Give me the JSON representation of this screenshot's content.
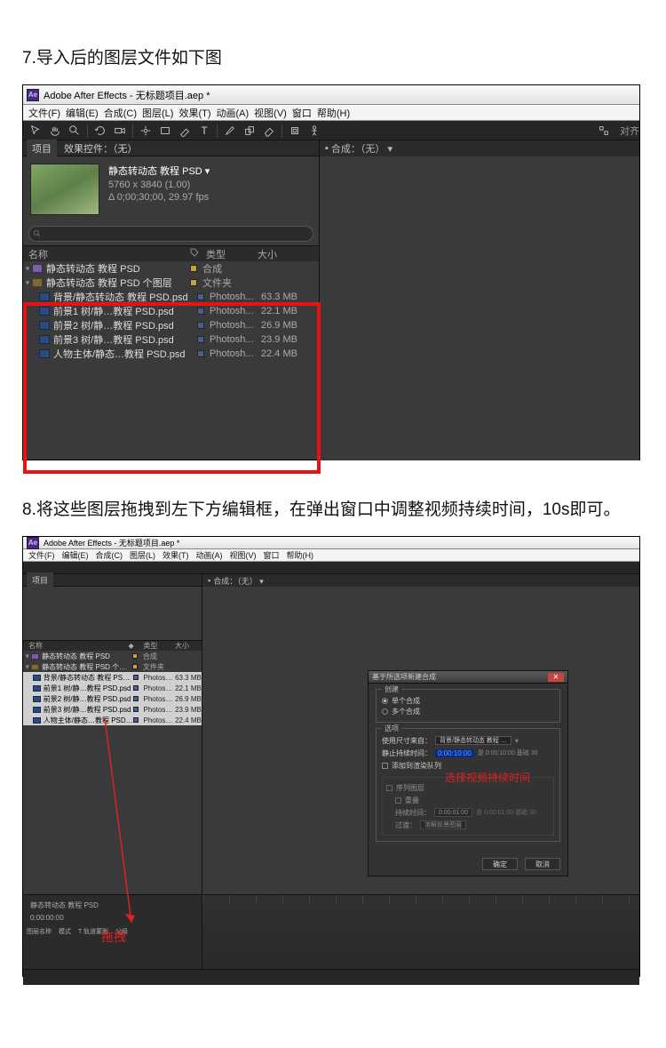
{
  "step7_text": "7.导入后的图层文件如下图",
  "step8_text": "8.将这些图层拖拽到左下方编辑框，在弹出窗口中调整视频持续时间，10s即可。",
  "ae": {
    "app_logo": "Ae",
    "title": "Adobe After Effects - 无标题项目.aep *",
    "menu": [
      "文件(F)",
      "编辑(E)",
      "合成(C)",
      "图层(L)",
      "效果(T)",
      "动画(A)",
      "视图(V)",
      "窗口",
      "帮助(H)"
    ],
    "align_label": "对齐"
  },
  "project": {
    "tab_project": "项目",
    "tab_effect": "效果控件：（无）",
    "comp_title": "静态转动态 教程 PSD ▾",
    "comp_dims": "5760 x 3840 (1.00)",
    "comp_dur": "Δ 0;00;30;00, 29.97 fps",
    "col_name": "名称",
    "col_type": "类型",
    "col_size": "大小"
  },
  "list": [
    {
      "icon": "comp",
      "name": "静态转动态 教程 PSD",
      "tag": "yellow",
      "type": "合成",
      "size": ""
    },
    {
      "icon": "folder",
      "name": "静态转动态 教程 PSD 个图层",
      "tag": "yellow",
      "type": "文件夹",
      "size": ""
    },
    {
      "icon": "ps",
      "name": "背景/静态转动态 教程 PSD.psd",
      "tag": "blue",
      "type": "Photosh...",
      "size": "63.3 MB"
    },
    {
      "icon": "ps",
      "name": "前景1 树/静…教程 PSD.psd",
      "tag": "blue",
      "type": "Photosh...",
      "size": "22.1 MB"
    },
    {
      "icon": "ps",
      "name": "前景2 树/静…教程 PSD.psd",
      "tag": "blue",
      "type": "Photosh...",
      "size": "26.9 MB"
    },
    {
      "icon": "ps",
      "name": "前景3 树/静…教程 PSD.psd",
      "tag": "blue",
      "type": "Photosh...",
      "size": "23.9 MB"
    },
    {
      "icon": "ps",
      "name": "人物主体/静态…教程 PSD.psd",
      "tag": "blue",
      "type": "Photosh...",
      "size": "22.4 MB"
    }
  ],
  "list2": [
    {
      "icon": "comp",
      "name": "静态转动态 教程 PSD",
      "tag": "yellow",
      "type": "合成",
      "size": ""
    },
    {
      "icon": "folder",
      "name": "静态转动态 教程 PSD 个图层",
      "tag": "yellow",
      "type": "文件夹",
      "size": ""
    },
    {
      "icon": "ps",
      "sel": true,
      "name": "背景/静态转动态 教程 PSD.psd",
      "tag": "blue",
      "type": "Photosh...",
      "size": "63.3 MB"
    },
    {
      "icon": "ps",
      "sel": true,
      "name": "前景1 树/静…教程 PSD.psd",
      "tag": "blue",
      "type": "Photosh...",
      "size": "22.1 MB"
    },
    {
      "icon": "ps",
      "sel": true,
      "name": "前景2 树/静…教程 PSD.psd",
      "tag": "blue",
      "type": "Photosh...",
      "size": "26.9 MB"
    },
    {
      "icon": "ps",
      "sel": true,
      "name": "前景3 树/静…教程 PSD.psd",
      "tag": "blue",
      "type": "Photosh...",
      "size": "23.9 MB"
    },
    {
      "icon": "ps",
      "sel": true,
      "name": "人物主体/静态…教程 PSD.psd",
      "tag": "blue",
      "type": "Photosh...",
      "size": "22.4 MB"
    }
  ],
  "comp_panel_tab": "合成：（无） ▾",
  "drag_label": "拖拽",
  "red_anno": "选择视频持续时间",
  "dialog": {
    "title": "基于所选项新建合成",
    "group_create": "创建",
    "radio_single": "单个合成",
    "radio_multi": "多个合成",
    "group_options": "选项",
    "use_dims_label": "使用尺寸来自：",
    "use_dims_value": "背景/静态转动态 教程 …",
    "still_dur_label": "静止持续时间：",
    "still_dur_value": "0:00:10:00",
    "still_dur_base": "是 0:00:10:00 基础 30",
    "add_to_rq": "添加到渲染队列",
    "seq_group": "序列图层",
    "seq_overlap": "重叠",
    "seq_dur_label": "持续时间：",
    "seq_dur_value": "0:00:01:00",
    "seq_dur_base": "是 0:00:01:00 基础 30",
    "seq_trans_label": "过渡：",
    "seq_trans_value": "溶解前景图层",
    "btn_ok": "确定",
    "btn_cancel": "取消"
  },
  "timeline": {
    "tab": "静态转动态 教程 PSD",
    "time": "0:00:00:00",
    "labels": [
      "图层名称",
      "模式",
      "T 轨道蒙版",
      "父级"
    ]
  }
}
